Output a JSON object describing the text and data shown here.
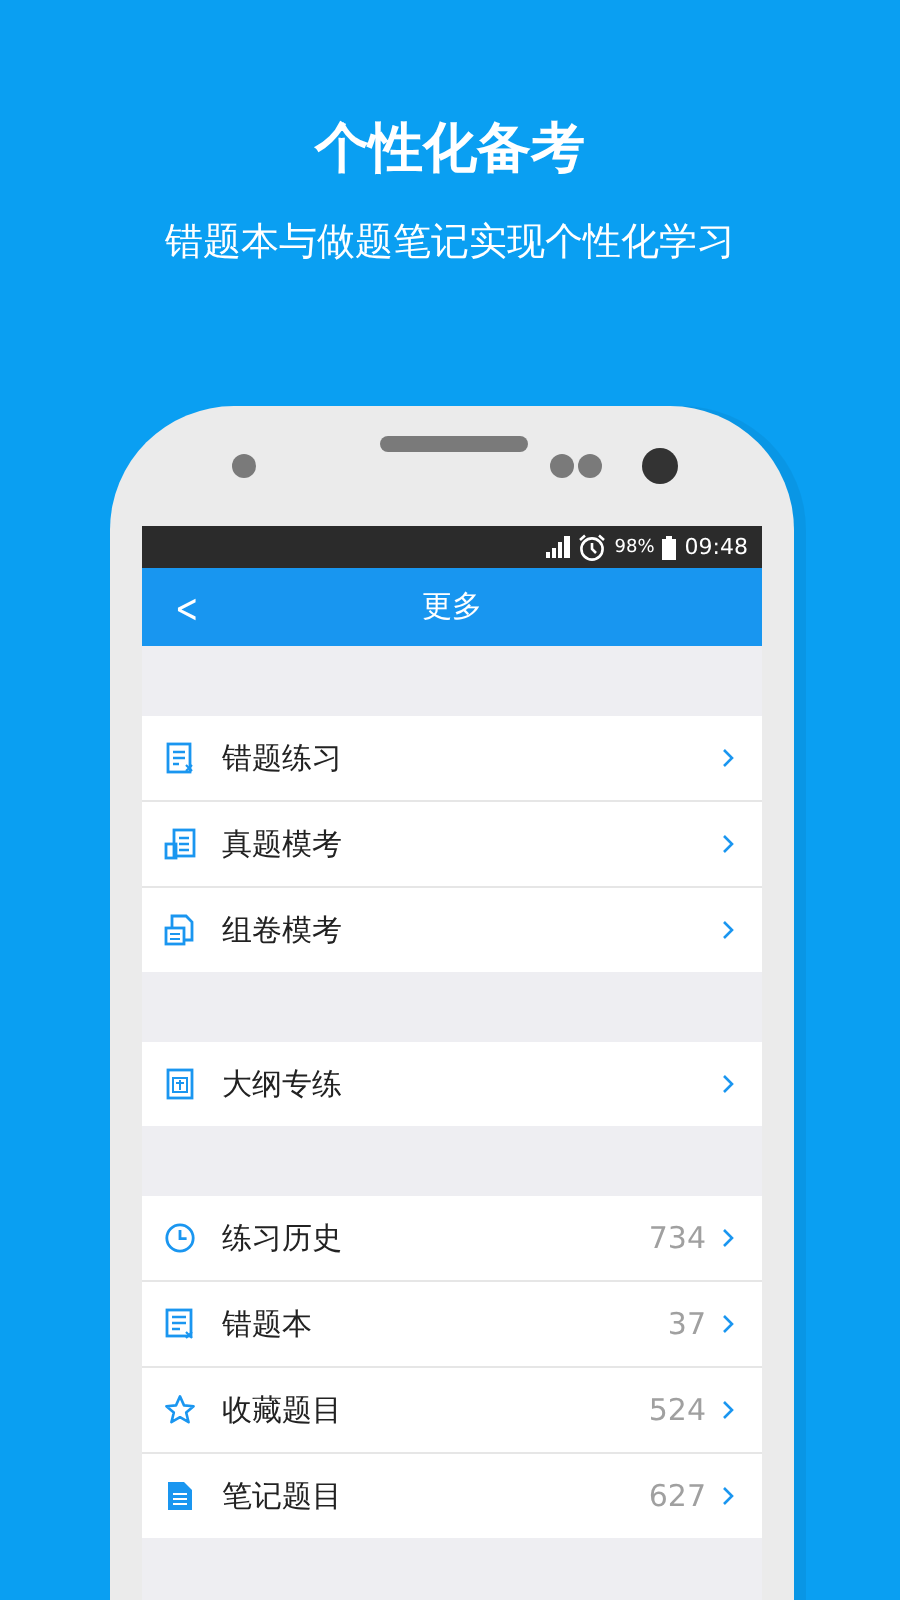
{
  "headline": "个性化备考",
  "subheadline": "错题本与做题笔记实现个性化学习",
  "status_bar": {
    "battery": "98%",
    "time": "09:48"
  },
  "nav_bar": {
    "back": "<",
    "title": "更多"
  },
  "sections": [
    {
      "items": [
        {
          "label": "错题练习"
        },
        {
          "label": "真题模考"
        },
        {
          "label": "组卷模考"
        }
      ]
    },
    {
      "items": [
        {
          "label": "大纲专练"
        }
      ]
    },
    {
      "items": [
        {
          "label": "练习历史",
          "count": "734"
        },
        {
          "label": "错题本",
          "count": "37"
        },
        {
          "label": "收藏题目",
          "count": "524"
        },
        {
          "label": "笔记题目",
          "count": "627"
        }
      ]
    }
  ]
}
